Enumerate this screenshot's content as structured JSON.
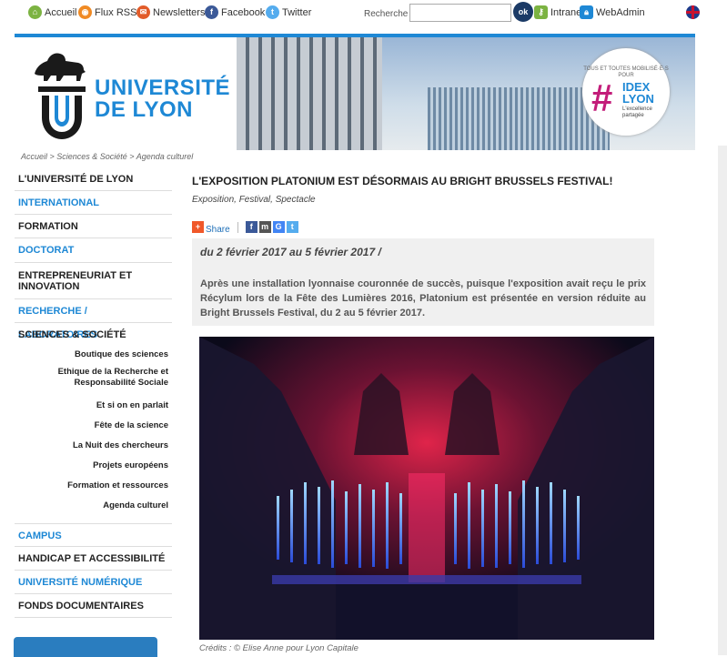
{
  "topbar": {
    "links": [
      {
        "label": "Accueil",
        "icon": "home-icon",
        "color": "#7cb342"
      },
      {
        "label": "Flux RSS",
        "icon": "rss-icon",
        "color": "#f08a24"
      },
      {
        "label": "Newsletters",
        "icon": "mail-icon",
        "color": "#e25b29"
      },
      {
        "label": "Facebook",
        "icon": "facebook-icon",
        "color": "#3b5998"
      },
      {
        "label": "Twitter",
        "icon": "twitter-icon",
        "color": "#55acee"
      }
    ],
    "search_label": "Recherche",
    "search_button": "ok",
    "intranet": "Intranet",
    "webadmin": "WebAdmin"
  },
  "header": {
    "logo_line1": "UNIVERSITÉ",
    "logo_line2": "DE LYON",
    "idex_top": "TOUS ET TOUTES MOBILISÉ·E·S POUR",
    "idex_hash": "#",
    "idex_name": "IDEX LYON",
    "idex_sub": "L'excellence partagée"
  },
  "breadcrumb": "Accueil > Sciences & Société > Agenda culturel",
  "sidebar": {
    "items": [
      {
        "label": "L'UNIVERSITÉ DE LYON",
        "color": "#222"
      },
      {
        "label": "INTERNATIONAL",
        "color": "#1e88d5"
      },
      {
        "label": "FORMATION",
        "color": "#222"
      },
      {
        "label": "DOCTORAT",
        "color": "#1e88d5"
      },
      {
        "label": "ENTREPRENEURIAT ET INNOVATION",
        "color": "#222"
      },
      {
        "label": "RECHERCHE / LABORATOIRES",
        "color": "#1e88d5"
      },
      {
        "label": "SCIENCES & SOCIÉTÉ",
        "color": "#222"
      }
    ],
    "subitems": [
      "Boutique des sciences",
      "Ethique de la Recherche et Responsabilité Sociale",
      "Et si on en parlait",
      "Fête de la science",
      "La Nuit des chercheurs",
      "Projets européens",
      "Formation et ressources",
      "Agenda culturel"
    ],
    "items_after": [
      {
        "label": "CAMPUS",
        "color": "#1e88d5"
      },
      {
        "label": "HANDICAP ET ACCESSIBILITÉ",
        "color": "#222"
      },
      {
        "label": "UNIVERSITÉ NUMÉRIQUE",
        "color": "#1e88d5"
      },
      {
        "label": "FONDS DOCUMENTAIRES",
        "color": "#222"
      }
    ]
  },
  "article": {
    "title": "L'EXPOSITION PLATONIUM EST DÉSORMAIS AU BRIGHT BRUSSELS FESTIVAL!",
    "tags": "Exposition, Festival, Spectacle",
    "share_label": "Share",
    "dates": "du 2 février 2017 au 5 février 2017 /",
    "summary": "Après une installation lyonnaise couronnée de succès, puisque l'exposition avait reçu le prix Récylum lors de la Fête des Lumières 2016, Platonium est présentée en version réduite au Bright Brussels Festival, du 2 au 5 février 2017.",
    "credits": "Crédits : © Elise Anne pour Lyon Capitale"
  }
}
